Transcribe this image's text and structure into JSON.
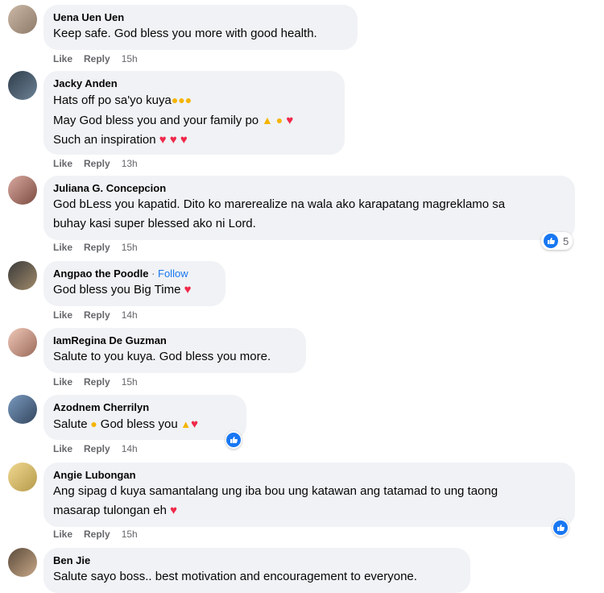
{
  "comments": [
    {
      "author": "Uena Uen Uen",
      "lines": [
        "Keep safe. God bless you more with good health."
      ],
      "like": "Like",
      "reply": "Reply",
      "time": "15h"
    },
    {
      "author": "Jacky Anden",
      "lines": [
        "Hats off po sa'yo kuya",
        "May God bless you and your family po",
        "Such an inspiration"
      ],
      "like": "Like",
      "reply": "Reply",
      "time": "13h"
    },
    {
      "author": "Juliana G. Concepcion",
      "lines": [
        "God bLess you kapatid. Dito ko marerealize na wala ako karapatang magreklamo sa",
        "buhay kasi super blessed ako ni Lord."
      ],
      "like": "Like",
      "reply": "Reply",
      "time": "15h",
      "reactions": "5"
    },
    {
      "author": "Angpao the Poodle",
      "follow": "Follow",
      "follow_dot": " · ",
      "lines": [
        "God bless you Big Time"
      ],
      "like": "Like",
      "reply": "Reply",
      "time": "14h"
    },
    {
      "author": "IamRegina De Guzman",
      "lines": [
        "Salute to you kuya. God bless you more."
      ],
      "like": "Like",
      "reply": "Reply",
      "time": "15h"
    },
    {
      "author": "Azodnem Cherrilyn",
      "lines": [
        "Salute",
        "God bless you"
      ],
      "like": "Like",
      "reply": "Reply",
      "time": "14h"
    },
    {
      "author": "Angie Lubongan",
      "lines": [
        "Ang sipag d kuya samantalang ung iba bou ung katawan ang tatamad to ung taong",
        "masarap tulongan eh"
      ],
      "like": "Like",
      "reply": "Reply",
      "time": "15h"
    },
    {
      "author": "Ben Jie",
      "lines": [
        "Salute sayo boss.. best motivation and encouragement to everyone."
      ]
    }
  ],
  "colors": {
    "bubble": "#f0f2f5",
    "link": "#1877f2",
    "meta": "#65676b",
    "heart": "#f02849"
  }
}
